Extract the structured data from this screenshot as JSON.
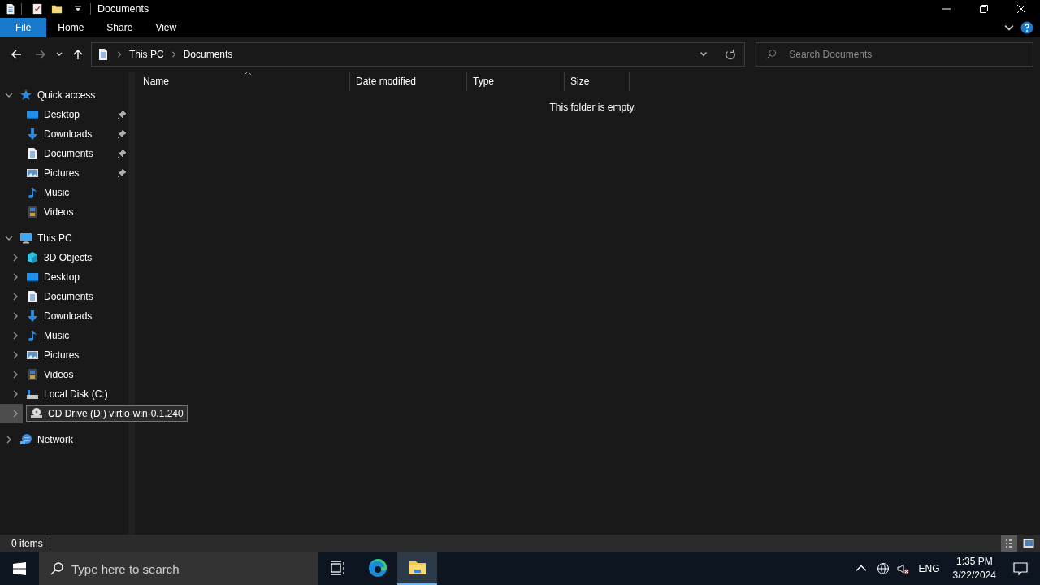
{
  "window": {
    "title": "Documents"
  },
  "ribbon": {
    "tabs": [
      {
        "label": "File",
        "kind": "file"
      },
      {
        "label": "Home",
        "kind": "tab"
      },
      {
        "label": "Share",
        "kind": "tab"
      },
      {
        "label": "View",
        "kind": "tab"
      }
    ]
  },
  "address": {
    "crumbs": [
      "This PC",
      "Documents"
    ]
  },
  "search": {
    "placeholder": "Search Documents"
  },
  "columns": [
    {
      "label": "Name",
      "sorted": true
    },
    {
      "label": "Date modified",
      "sorted": false
    },
    {
      "label": "Type",
      "sorted": false
    },
    {
      "label": "Size",
      "sorted": false
    }
  ],
  "empty_message": "This folder is empty.",
  "nav": [
    {
      "label": "Quick access",
      "kind": "star",
      "expanded": true,
      "children": [
        {
          "label": "Desktop",
          "kind": "desktop",
          "pinned": true
        },
        {
          "label": "Downloads",
          "kind": "download",
          "pinned": true
        },
        {
          "label": "Documents",
          "kind": "document",
          "pinned": true
        },
        {
          "label": "Pictures",
          "kind": "pictures",
          "pinned": true
        },
        {
          "label": "Music",
          "kind": "music",
          "pinned": false
        },
        {
          "label": "Videos",
          "kind": "videos",
          "pinned": false
        }
      ]
    },
    {
      "label": "This PC",
      "kind": "pc",
      "expanded": true,
      "children": [
        {
          "label": "3D Objects",
          "kind": "cube",
          "hovered": false
        },
        {
          "label": "Desktop",
          "kind": "desktop",
          "hovered": false
        },
        {
          "label": "Documents",
          "kind": "document",
          "hovered": false
        },
        {
          "label": "Downloads",
          "kind": "download",
          "hovered": false
        },
        {
          "label": "Music",
          "kind": "music",
          "hovered": false
        },
        {
          "label": "Pictures",
          "kind": "pictures",
          "hovered": false
        },
        {
          "label": "Videos",
          "kind": "videos",
          "hovered": false
        },
        {
          "label": "Local Disk (C:)",
          "kind": "disk",
          "hovered": false
        },
        {
          "label": "CD Drive (D:) virtio-win-0.1.240",
          "kind": "cd",
          "hovered": true
        }
      ]
    },
    {
      "label": "Network",
      "kind": "network",
      "expanded": false
    }
  ],
  "status_bar": {
    "count": "0 items",
    "views": [
      {
        "kind": "details",
        "selected": true
      },
      {
        "kind": "large",
        "selected": false
      }
    ]
  },
  "taskbar": {
    "search_placeholder": "Type here to search",
    "apps": [
      {
        "kind": "taskview",
        "active": false
      },
      {
        "kind": "edge",
        "active": false
      },
      {
        "kind": "explorer",
        "active": true
      }
    ],
    "language": "ENG",
    "time": "1:35 PM",
    "date": "3/22/2024"
  }
}
